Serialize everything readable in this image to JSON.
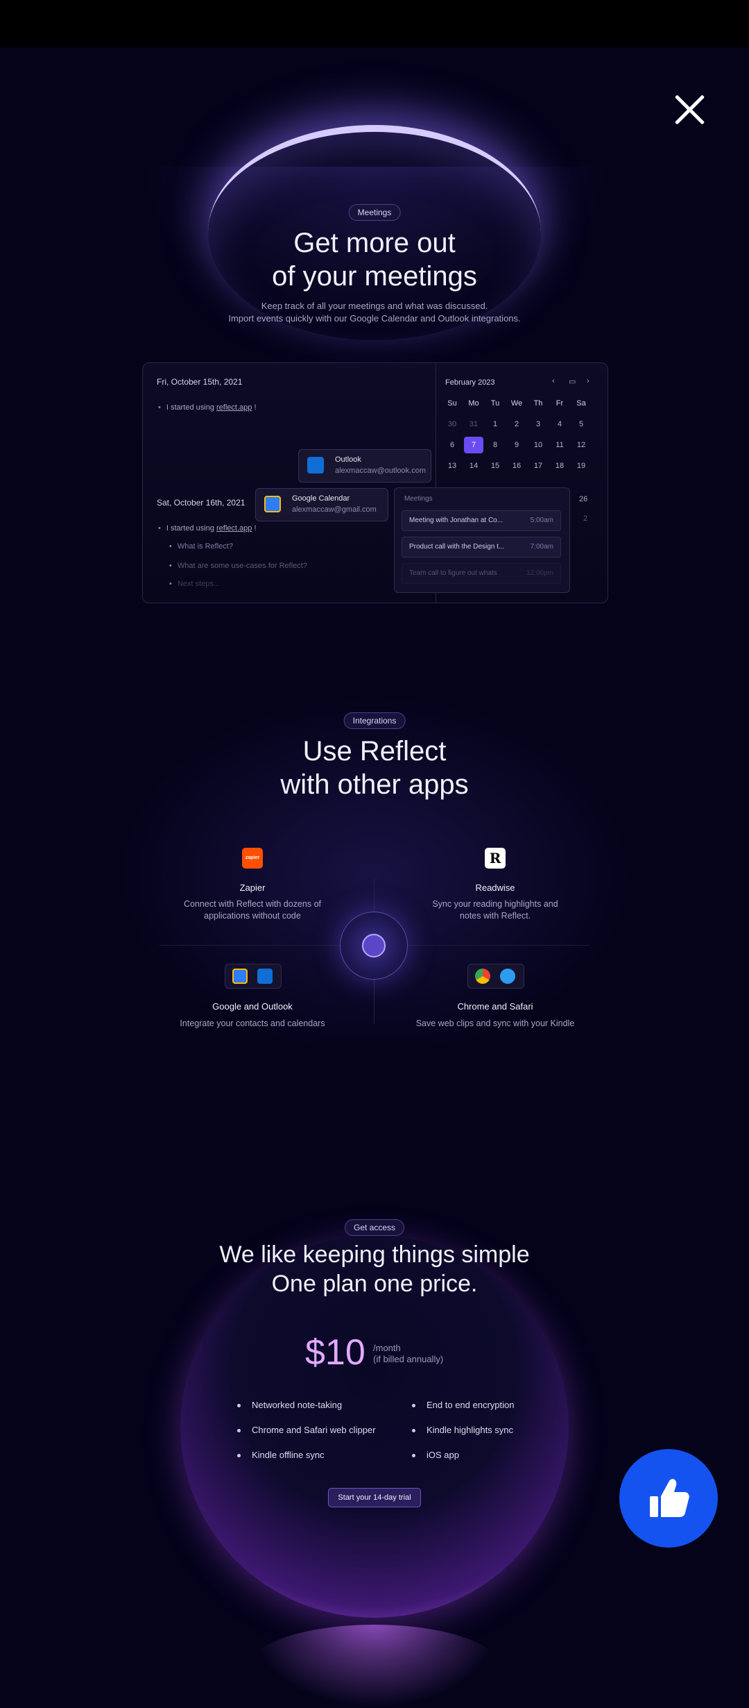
{
  "meetings": {
    "badge": "Meetings",
    "title_line1": "Get more out",
    "title_line2": "of your meetings",
    "sub_line1": "Keep track of all your meetings and what was discussed.",
    "sub_line2": "Import events quickly with our Google Calendar and Outlook integrations."
  },
  "mock": {
    "day1": "Fri, October 15th, 2021",
    "day1_note_prefix": "I started using ",
    "day1_note_link": "reflect.app",
    "day1_note_suffix": " !",
    "day2": "Sat, October 16th, 2021",
    "day2_note_prefix": "I started using ",
    "day2_note_link": "reflect.app",
    "day2_note_suffix": " !",
    "q1": "What is Reflect?",
    "q2": "What are some use-cases for Reflect?",
    "q3": "Next steps...",
    "outlook_name": "Outlook",
    "outlook_email": "alexmaccaw@outlook.com",
    "google_name": "Google Calendar",
    "google_email": "alexmaccaw@gmail.com",
    "calendar_month": "February 2023",
    "weekdays": [
      "Su",
      "Mo",
      "Tu",
      "We",
      "Th",
      "Fr",
      "Sa"
    ],
    "week1": [
      "30",
      "31",
      "1",
      "2",
      "3",
      "4",
      "5"
    ],
    "week2": [
      "6",
      "7",
      "8",
      "9",
      "10",
      "11",
      "12"
    ],
    "week3": [
      "13",
      "14",
      "15",
      "16",
      "17",
      "18",
      "19"
    ],
    "extra1": "26",
    "extra2": "2",
    "meetings_label": "Meetings",
    "meeting1_name": "Meeting with Jonathan at Co...",
    "meeting1_time": "5:00am",
    "meeting2_name": "Product call with the Design t...",
    "meeting2_time": "7:00am",
    "meeting3_name": "Team call to figure out whats",
    "meeting3_time": "12:00pm"
  },
  "integrations": {
    "badge": "Integrations",
    "title_line1": "Use Reflect",
    "title_line2": "with other apps",
    "zapier_logo": "zapier",
    "zapier_name": "Zapier",
    "zapier_desc1": "Connect with Reflect with dozens of",
    "zapier_desc2": "applications without code",
    "readwise_logo": "R",
    "readwise_name": "Readwise",
    "readwise_desc1": "Sync your reading highlights and",
    "readwise_desc2": "notes with Reflect.",
    "go_name": "Google and Outlook",
    "go_desc": "Integrate your contacts and calendars",
    "cs_name": "Chrome and Safari",
    "cs_desc": "Save web clips and sync with your Kindle"
  },
  "pricing": {
    "badge": "Get access",
    "title_line1": "We like keeping things simple",
    "title_line2": "One plan one price.",
    "price": "$10",
    "per_line1": "/month",
    "per_line2": "(if billed annually)",
    "features_left": [
      "Networked note-taking",
      "Chrome and Safari web clipper",
      "Kindle offline sync"
    ],
    "features_right": [
      "End to end encryption",
      "Kindle highlights sync",
      "iOS app"
    ],
    "cta": "Start your 14-day trial"
  },
  "colors": {
    "accent": "#6a4cf0",
    "fab": "#1553f0",
    "price": "#e3a9ff"
  },
  "icons": {
    "close": "close-icon",
    "fab": "thumbs-up-icon"
  }
}
